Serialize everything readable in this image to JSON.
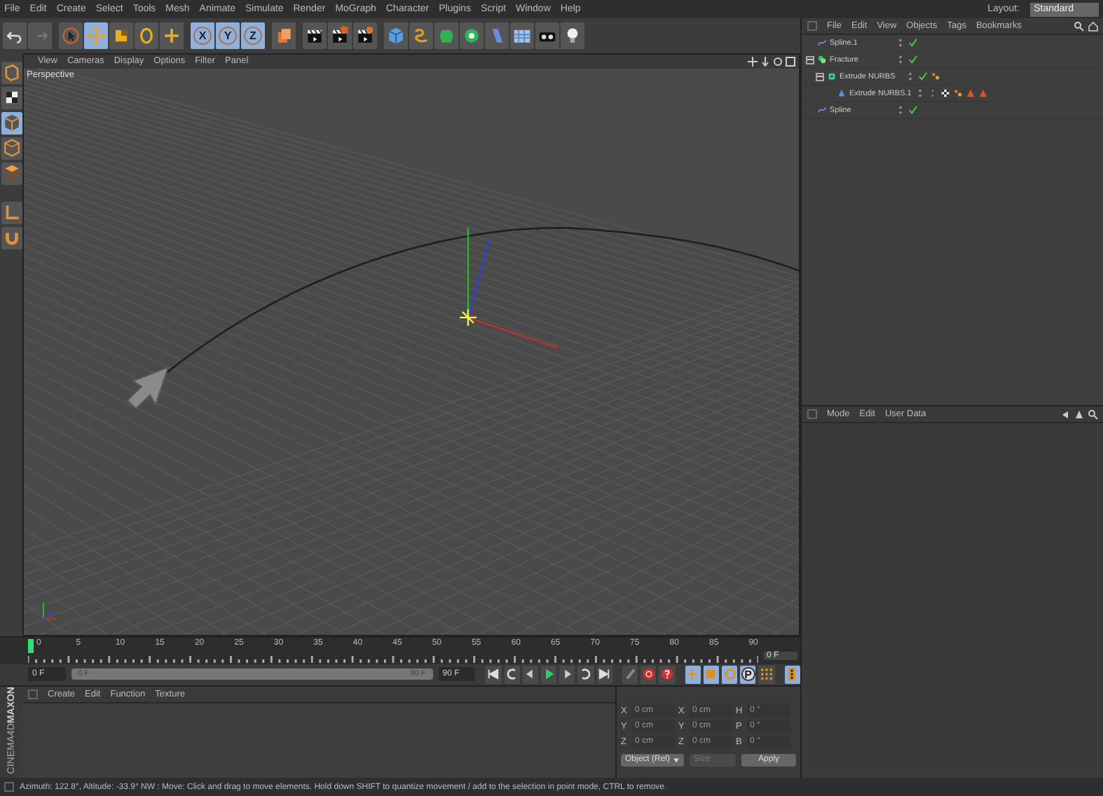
{
  "menu_bar": {
    "items": [
      "File",
      "Edit",
      "Create",
      "Select",
      "Tools",
      "Mesh",
      "Animate",
      "Simulate",
      "Render",
      "MoGraph",
      "Character",
      "Plugins",
      "Script",
      "Window",
      "Help"
    ],
    "layout_label": "Layout:",
    "layout_value": "Standard"
  },
  "toolbar": [
    {
      "kind": "undo",
      "selected": false
    },
    {
      "kind": "redo",
      "selected": false
    },
    {
      "kind": "select",
      "selected": false
    },
    {
      "kind": "move",
      "selected": true
    },
    {
      "kind": "scale",
      "selected": false
    },
    {
      "kind": "rotate",
      "selected": false
    },
    {
      "kind": "recent",
      "selected": false
    },
    {
      "kind": "axis",
      "label": "X",
      "selected": true
    },
    {
      "kind": "axis",
      "label": "Y",
      "selected": true
    },
    {
      "kind": "axis",
      "label": "Z",
      "selected": true
    },
    {
      "kind": "coordinates",
      "selected": false
    },
    {
      "kind": "render-view",
      "selected": false
    },
    {
      "kind": "render-picture",
      "selected": false
    },
    {
      "kind": "render-settings",
      "selected": false
    },
    {
      "kind": "cube",
      "selected": false
    },
    {
      "kind": "spline",
      "selected": false
    },
    {
      "kind": "nurbs",
      "selected": false
    },
    {
      "kind": "array",
      "selected": false
    },
    {
      "kind": "deformer",
      "selected": false
    },
    {
      "kind": "floor",
      "selected": false
    },
    {
      "kind": "camera",
      "selected": false
    },
    {
      "kind": "light",
      "selected": false
    }
  ],
  "side_toolbar": [
    {
      "kind": "editable",
      "selected": false
    },
    {
      "kind": "texture",
      "selected": false
    },
    {
      "kind": "model",
      "selected": true
    },
    {
      "kind": "edges",
      "selected": false
    },
    {
      "kind": "polygons",
      "selected": false
    },
    {
      "kind": "axis-mode",
      "selected": false
    },
    {
      "kind": "snap",
      "selected": false
    }
  ],
  "viewport": {
    "menu": [
      "View",
      "Cameras",
      "Display",
      "Options",
      "Filter",
      "Panel"
    ],
    "camera_label": "Perspective"
  },
  "object_manager": {
    "menu": [
      "File",
      "Edit",
      "View",
      "Objects",
      "Tags",
      "Bookmarks"
    ],
    "objects": [
      {
        "name": "Spline.1",
        "kind": "spline",
        "enabled": true
      },
      {
        "name": "Fracture",
        "kind": "fracture",
        "enabled": true,
        "expanded": true,
        "children": [
          {
            "name": "Extrude NURBS",
            "kind": "extrude",
            "enabled": true,
            "expanded": true,
            "tags": [
              {
                "kind": "phong"
              }
            ],
            "children": [
              {
                "name": "Extrude NURBS.1",
                "kind": "extrude-child",
                "enabled": false,
                "tags": [
                  {
                    "kind": "texture"
                  },
                  {
                    "kind": "phong"
                  },
                  {
                    "kind": "warning"
                  },
                  {
                    "kind": "warning"
                  }
                ]
              }
            ]
          }
        ]
      },
      {
        "name": "Spline",
        "kind": "spline",
        "enabled": true
      }
    ]
  },
  "attribute_manager": {
    "menu": [
      "Mode",
      "Edit",
      "User Data"
    ]
  },
  "timeline": {
    "ticks": [
      "0",
      "5",
      "10",
      "15",
      "20",
      "25",
      "30",
      "35",
      "40",
      "45",
      "50",
      "55",
      "60",
      "65",
      "70",
      "75",
      "80",
      "85",
      "90"
    ],
    "level": 0,
    "current_frame": "0 F"
  },
  "playback": {
    "start_field": "0 F",
    "range_start": "0 F",
    "range_end": "90 F",
    "level": 1,
    "end_field": "90 F",
    "buttons": [
      {
        "kind": "go-start",
        "selected": false
      },
      {
        "kind": "prev-key",
        "selected": false
      },
      {
        "kind": "prev-frame",
        "selected": false
      },
      {
        "kind": "play",
        "selected": false
      },
      {
        "kind": "next-frame",
        "selected": false
      },
      {
        "kind": "loop",
        "selected": false
      },
      {
        "kind": "go-end",
        "selected": false
      },
      {
        "kind": "record",
        "selected": false
      },
      {
        "kind": "autokey",
        "selected": false
      },
      {
        "kind": "key-selection",
        "selected": false
      },
      {
        "kind": "key-position",
        "selected": true
      },
      {
        "kind": "key-scale",
        "selected": true
      },
      {
        "kind": "key-rotation",
        "selected": true
      },
      {
        "kind": "key-parameter",
        "label": "P",
        "selected": true
      },
      {
        "kind": "key-points",
        "selected": false
      },
      {
        "kind": "timeline",
        "selected": true
      }
    ]
  },
  "material_manager": {
    "menu": [
      "Create",
      "Edit",
      "Function",
      "Texture"
    ],
    "logo": [
      "MAXON",
      "CINEMA4D"
    ]
  },
  "coordinates": {
    "rows": [
      {
        "axis": "X",
        "position": "0 cm",
        "size_axis": "X",
        "size": "0 cm",
        "rot_axis": "H",
        "rotation": "0 °"
      },
      {
        "axis": "Y",
        "position": "0 cm",
        "size_axis": "Y",
        "size": "0 cm",
        "rot_axis": "P",
        "rotation": "0 °"
      },
      {
        "axis": "Z",
        "position": "0 cm",
        "size_axis": "Z",
        "size": "0 cm",
        "rot_axis": "B",
        "rotation": "0 °"
      }
    ],
    "mode": "Object (Rel)",
    "size_mode": "Size",
    "apply": "Apply"
  },
  "status_bar": "Azimuth: 122.8°, Altitude: -33.9°  NW : Move: Click and drag to move elements. Hold down SHIFT to quantize movement / add to the selection in point mode, CTRL to remove."
}
